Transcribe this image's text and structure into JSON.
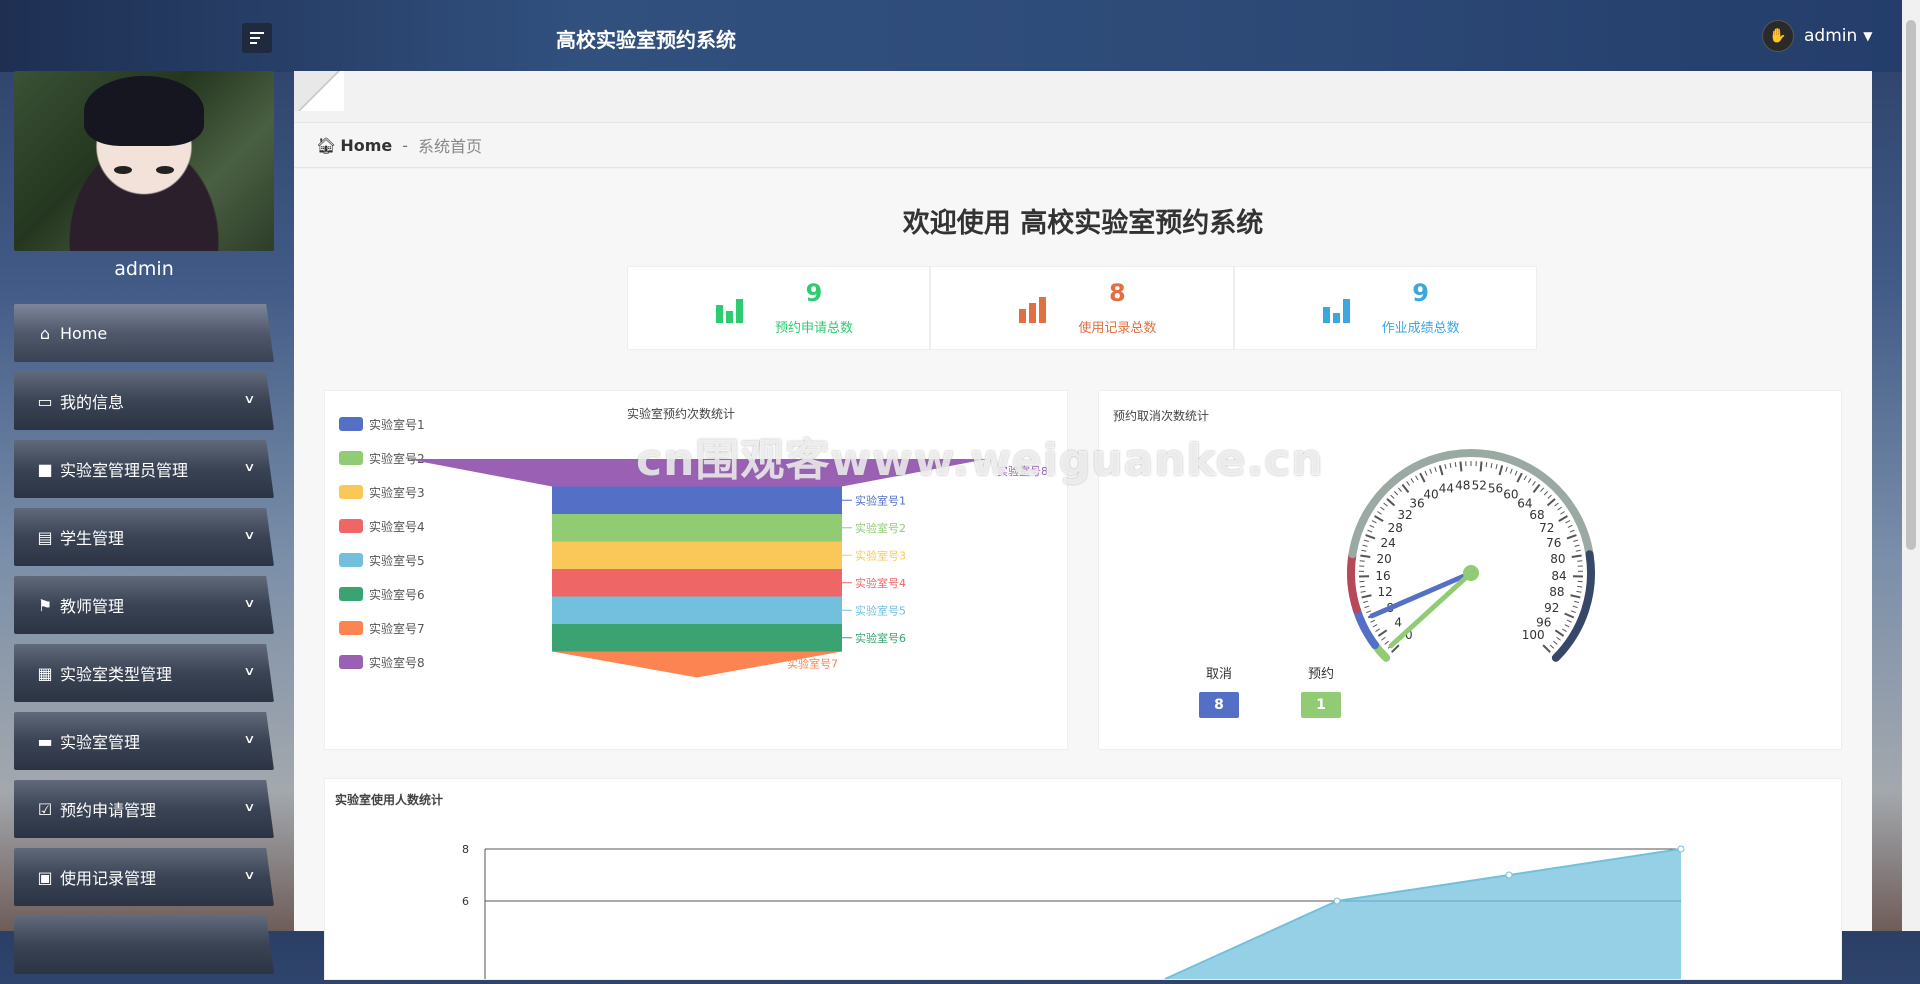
{
  "app": {
    "title": "高校实验室预约系统",
    "user": "admin"
  },
  "sidebar": {
    "username": "admin",
    "items": [
      {
        "label": "Home",
        "icon": "house-icon"
      },
      {
        "label": "我的信息",
        "icon": "id-card-icon"
      },
      {
        "label": "实验室管理员管理",
        "icon": "briefcase-icon"
      },
      {
        "label": "学生管理",
        "icon": "clipboard-icon"
      },
      {
        "label": "教师管理",
        "icon": "flag-icon"
      },
      {
        "label": "实验室类型管理",
        "icon": "grid-icon"
      },
      {
        "label": "实验室管理",
        "icon": "monitor-icon"
      },
      {
        "label": "预约申请管理",
        "icon": "clipboard-check-icon"
      },
      {
        "label": "使用记录管理",
        "icon": "chat-icon"
      }
    ]
  },
  "breadcrumb": {
    "home": "Home",
    "separator": "-",
    "current": "系统首页"
  },
  "welcome": "欢迎使用 高校实验室预约系统",
  "stats": [
    {
      "value": "9",
      "label": "预约申请总数",
      "color": "#2ecc71"
    },
    {
      "value": "8",
      "label": "使用记录总数",
      "color": "#e0703f"
    },
    {
      "value": "9",
      "label": "作业成绩总数",
      "color": "#3aa8de"
    }
  ],
  "watermark": "cn围观客www.weiguanke.cn",
  "chart_data": [
    {
      "type": "funnel",
      "title": "实验室预约次数统计",
      "categories": [
        "实验室号1",
        "实验室号2",
        "实验室号3",
        "实验室号4",
        "实验室号5",
        "实验室号6",
        "实验室号7",
        "实验室号8"
      ],
      "colors": [
        "#5470c6",
        "#91cc75",
        "#fac858",
        "#ee6666",
        "#73c0de",
        "#3ba272",
        "#fc8452",
        "#9a60b4"
      ]
    },
    {
      "type": "gauge",
      "title": "预约取消次数统计",
      "min": 0,
      "max": 100,
      "ticks": [
        "0",
        "4",
        "8",
        "12",
        "16",
        "20",
        "24",
        "28",
        "32",
        "36",
        "40",
        "44",
        "48",
        "52",
        "56",
        "60",
        "64",
        "68",
        "72",
        "76",
        "80",
        "84",
        "88",
        "92",
        "96",
        "100"
      ],
      "series": [
        {
          "name": "取消",
          "value": 8,
          "color": "#5470c6"
        },
        {
          "name": "预约",
          "value": 1,
          "color": "#91cc75"
        }
      ]
    },
    {
      "type": "area",
      "title": "实验室使用人数统计",
      "yticks": [
        "8",
        "6"
      ],
      "color": "#73c0de"
    }
  ]
}
